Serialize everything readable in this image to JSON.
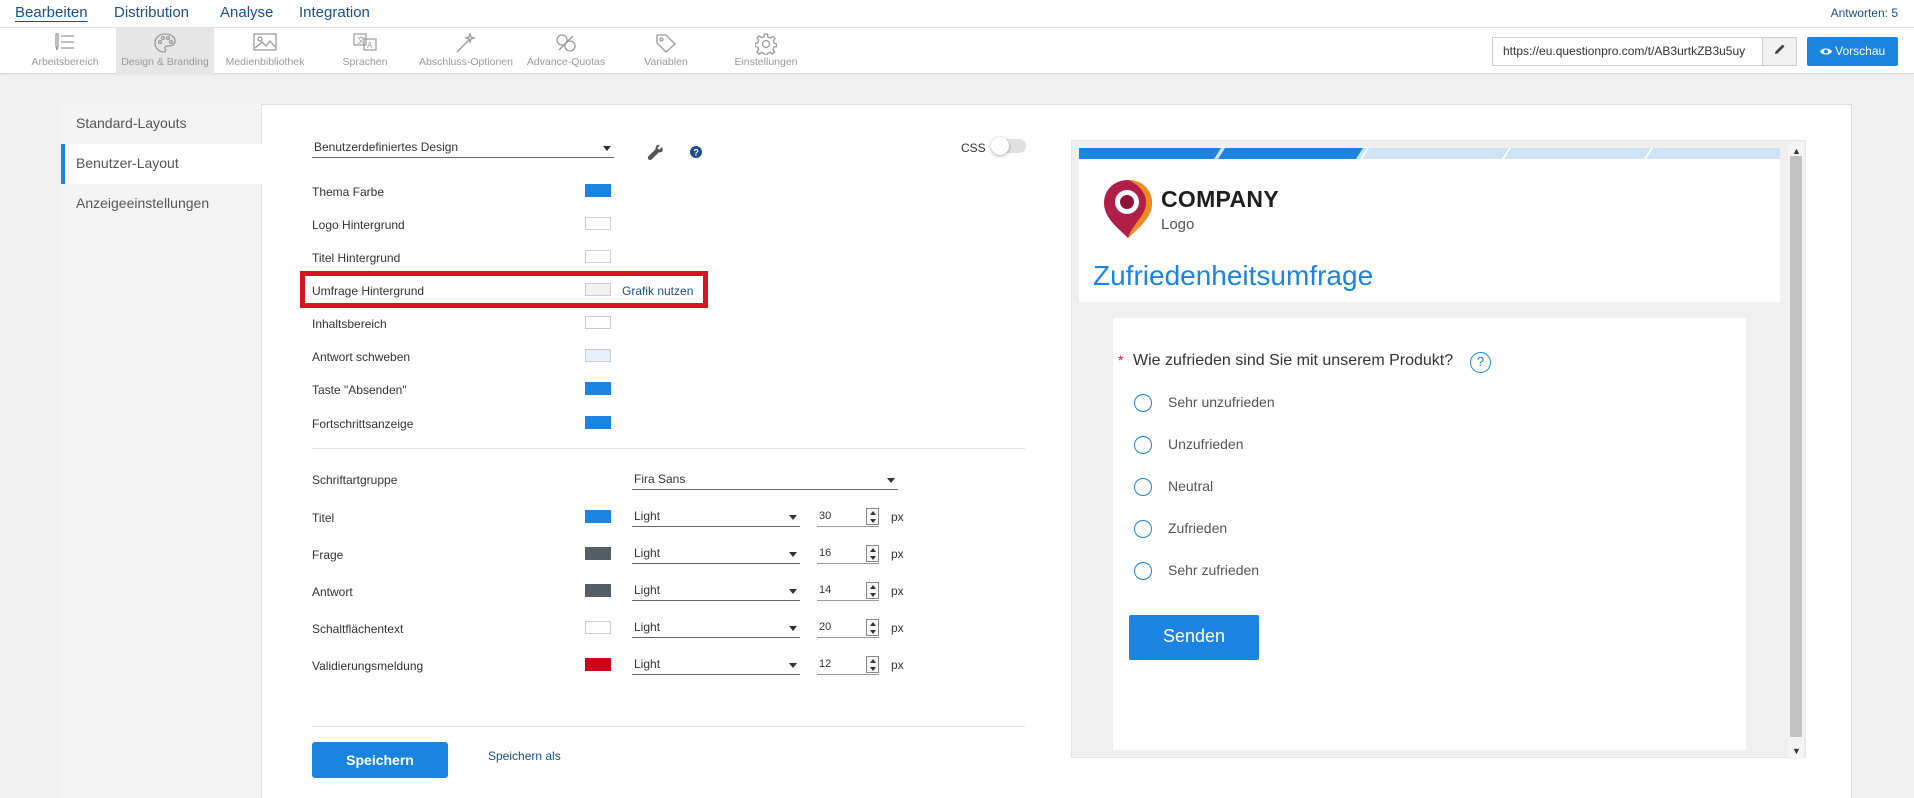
{
  "topnav": {
    "tabs": [
      {
        "label": "Bearbeiten"
      },
      {
        "label": "Distribution"
      },
      {
        "label": "Analyse"
      },
      {
        "label": "Integration"
      }
    ],
    "answers": "Antworten: 5"
  },
  "toolbar": {
    "tools": [
      {
        "label": "Arbeitsbereich",
        "icon": "list-edit-icon"
      },
      {
        "label": "Design & Branding",
        "icon": "palette-icon"
      },
      {
        "label": "Medienbibliothek",
        "icon": "image-icon"
      },
      {
        "label": "Sprachen",
        "icon": "translate-icon"
      },
      {
        "label": "Abschluss-Optionen",
        "icon": "magic-wand-icon"
      },
      {
        "label": "Advance-Quotas",
        "icon": "quota-icon"
      },
      {
        "label": "Variablen",
        "icon": "tag-icon"
      },
      {
        "label": "Einstellungen",
        "icon": "gear-icon"
      }
    ],
    "url": "https://eu.questionpro.com/t/AB3urtkZB3u5uy",
    "preview_label": "Vorschau"
  },
  "sidenav": {
    "items": [
      {
        "label": "Standard-Layouts"
      },
      {
        "label": "Benutzer-Layout"
      },
      {
        "label": "Anzeigeeinstellungen"
      }
    ]
  },
  "design": {
    "selected": "Benutzerdefiniertes Design",
    "css_label": "CSS",
    "css_enabled": false
  },
  "colors": {
    "rows": [
      {
        "label": "Thema Farbe",
        "color": "#1a84e0"
      },
      {
        "label": "Logo Hintergrund",
        "color": "#ffffff"
      },
      {
        "label": "Titel Hintergrund",
        "color": "#ffffff"
      },
      {
        "label": "Umfrage Hintergrund",
        "color": "#f2f2f2",
        "action": "Grafik nutzen"
      },
      {
        "label": "Inhaltsbereich",
        "color": "#ffffff"
      },
      {
        "label": "Antwort schweben",
        "color": "#e8f1fb"
      },
      {
        "label": "Taste \"Absenden\"",
        "color": "#1a84e0"
      },
      {
        "label": "Fortschrittsanzeige",
        "color": "#1a84e0"
      }
    ]
  },
  "fonts": {
    "group_label": "Schriftartgruppe",
    "group_value": "Fira Sans",
    "unit": "px",
    "rows": [
      {
        "label": "Titel",
        "color": "#1a84e0",
        "weight": "Light",
        "size": "30"
      },
      {
        "label": "Frage",
        "color": "#555e66",
        "weight": "Light",
        "size": "16"
      },
      {
        "label": "Antwort",
        "color": "#555e66",
        "weight": "Light",
        "size": "14"
      },
      {
        "label": "Schaltflächentext",
        "color": "#ffffff",
        "weight": "Light",
        "size": "20"
      },
      {
        "label": "Validierungsmeldung",
        "color": "#d0021b",
        "weight": "Light",
        "size": "12"
      }
    ]
  },
  "actions": {
    "save": "Speichern",
    "save_as": "Speichern als"
  },
  "preview": {
    "company": "COMPANY",
    "company_sub": "Logo",
    "title": "Zufriedenheitsumfrage",
    "required_mark": "*",
    "question": "Wie zufrieden sind Sie mit unserem Produkt?",
    "help": "?",
    "options": [
      "Sehr unzufrieden",
      "Unzufrieden",
      "Neutral",
      "Zufrieden",
      "Sehr zufrieden"
    ],
    "submit": "Senden"
  }
}
